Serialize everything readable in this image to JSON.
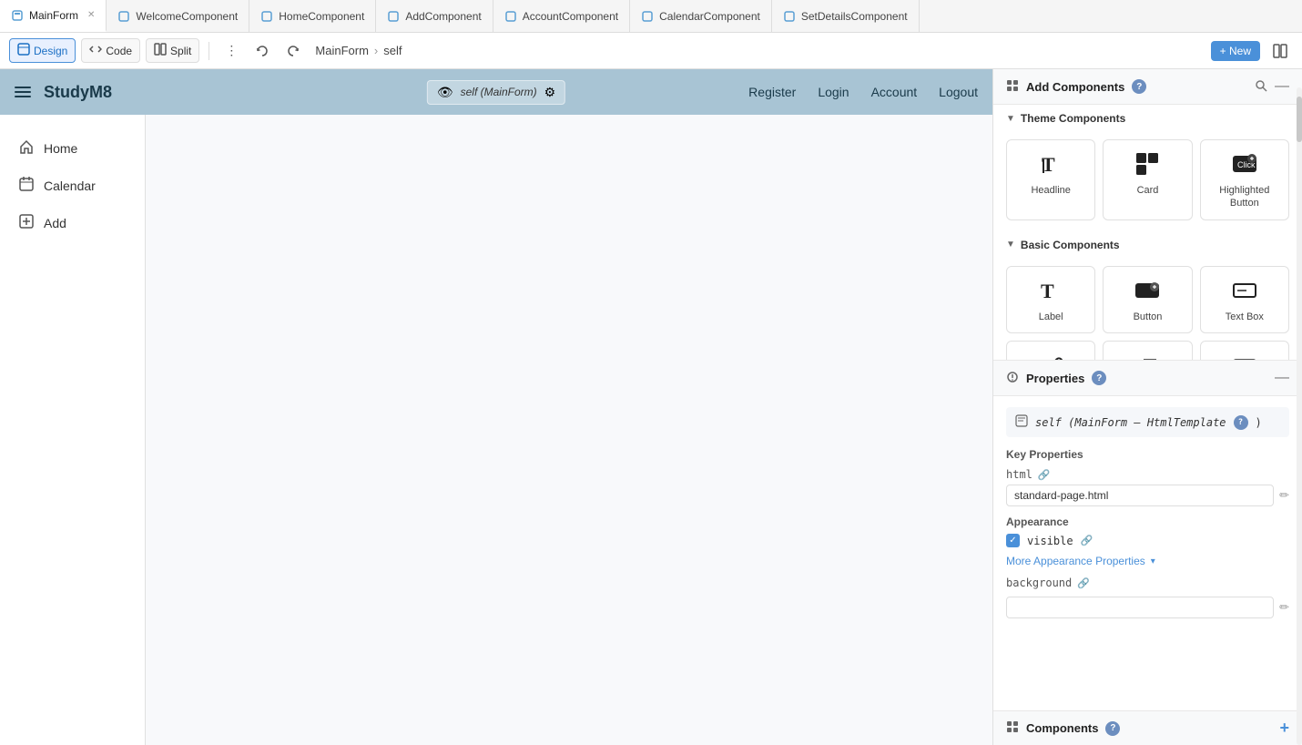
{
  "tabs": [
    {
      "id": "mainform",
      "label": "MainForm",
      "active": true,
      "closable": true,
      "icon": "⬡"
    },
    {
      "id": "welcome",
      "label": "WelcomeComponent",
      "active": false,
      "icon": "⬡"
    },
    {
      "id": "home",
      "label": "HomeComponent",
      "active": false,
      "icon": "⬡"
    },
    {
      "id": "add",
      "label": "AddComponent",
      "active": false,
      "icon": "⬡"
    },
    {
      "id": "account",
      "label": "AccountComponent",
      "active": false,
      "icon": "⬡"
    },
    {
      "id": "calendar",
      "label": "CalendarComponent",
      "active": false,
      "icon": "⬡"
    },
    {
      "id": "setdetails",
      "label": "SetDetailsComponent",
      "active": false,
      "icon": "⬡"
    }
  ],
  "toolbar": {
    "design_label": "Design",
    "code_label": "Code",
    "split_label": "Split",
    "breadcrumb_form": "MainForm",
    "breadcrumb_item": "self",
    "new_label": "+ New"
  },
  "app_preview": {
    "title": "StudyM8",
    "selector_text": "self (MainForm)",
    "nav_links": [
      "Register",
      "Login",
      "Account",
      "Logout"
    ],
    "sidebar_items": [
      {
        "label": "Home",
        "icon": "⊕"
      },
      {
        "label": "Calendar",
        "icon": "📅"
      },
      {
        "label": "Add",
        "icon": "➕"
      }
    ]
  },
  "add_components": {
    "title": "Add Components",
    "help": "?",
    "theme_section": "Theme Components",
    "theme_items": [
      {
        "label": "Headline",
        "icon_type": "headline"
      },
      {
        "label": "Card",
        "icon_type": "card"
      },
      {
        "label": "Highlighted Button",
        "icon_type": "highlighted-button"
      }
    ],
    "basic_section": "Basic Components",
    "basic_items": [
      {
        "label": "Label",
        "icon_type": "label"
      },
      {
        "label": "Button",
        "icon_type": "button"
      },
      {
        "label": "Text Box",
        "icon_type": "textbox"
      },
      {
        "label": "",
        "icon_type": "link"
      },
      {
        "label": "",
        "icon_type": "text2"
      },
      {
        "label": "",
        "icon_type": "input2"
      }
    ]
  },
  "properties": {
    "title": "Properties",
    "help": "?",
    "ref_label": "self (MainForm – HtmlTemplate",
    "help2": "?",
    "key_properties_title": "Key Properties",
    "html_label": "html",
    "html_value": "standard-page.html",
    "appearance_title": "Appearance",
    "visible_label": "visible",
    "more_appearance_label": "More Appearance Properties",
    "background_label": "background",
    "components_title": "Components"
  },
  "colors": {
    "accent": "#4a90d9",
    "nav_bg": "#a8c4d4",
    "sidebar_bg": "#1a3a4a",
    "panel_bg": "#f8f9fa",
    "check_blue": "#4a90d9"
  }
}
